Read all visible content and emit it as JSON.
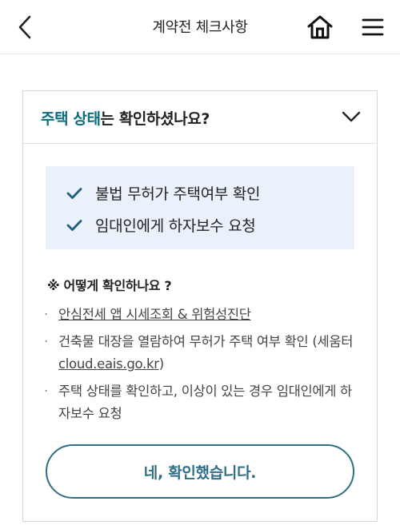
{
  "header": {
    "title": "계약전 체크사항",
    "back_icon": "chevron-left-icon",
    "home_icon": "home-icon",
    "menu_icon": "hamburger-menu-icon"
  },
  "card": {
    "title_accent": "주택 상태",
    "title_rest": "는 확인하셨나요?",
    "toggle_icon": "chevron-down-icon",
    "accent_color": "#0b6e7e",
    "checklist": [
      {
        "label": "불법 무허가 주택여부 확인"
      },
      {
        "label": "임대인에게 하자보수 요청"
      }
    ],
    "how_title": "※ 어떻게 확인하나요 ?",
    "bullets": [
      {
        "link": "안심전세 앱 시세조회 & 위험성진단"
      },
      {
        "text": "건축물 대장을 열람하여 무허가 주택 여부 확인 (세움터 ",
        "link": "cloud.eais.go.kr",
        "suffix": ")"
      },
      {
        "text": "주택 상태를 확인하고, 이상이 있는 경우 임대인에게 하자보수 요청"
      }
    ],
    "confirm_label": "네, 확인했습니다.",
    "button_color": "#2f6f86"
  }
}
